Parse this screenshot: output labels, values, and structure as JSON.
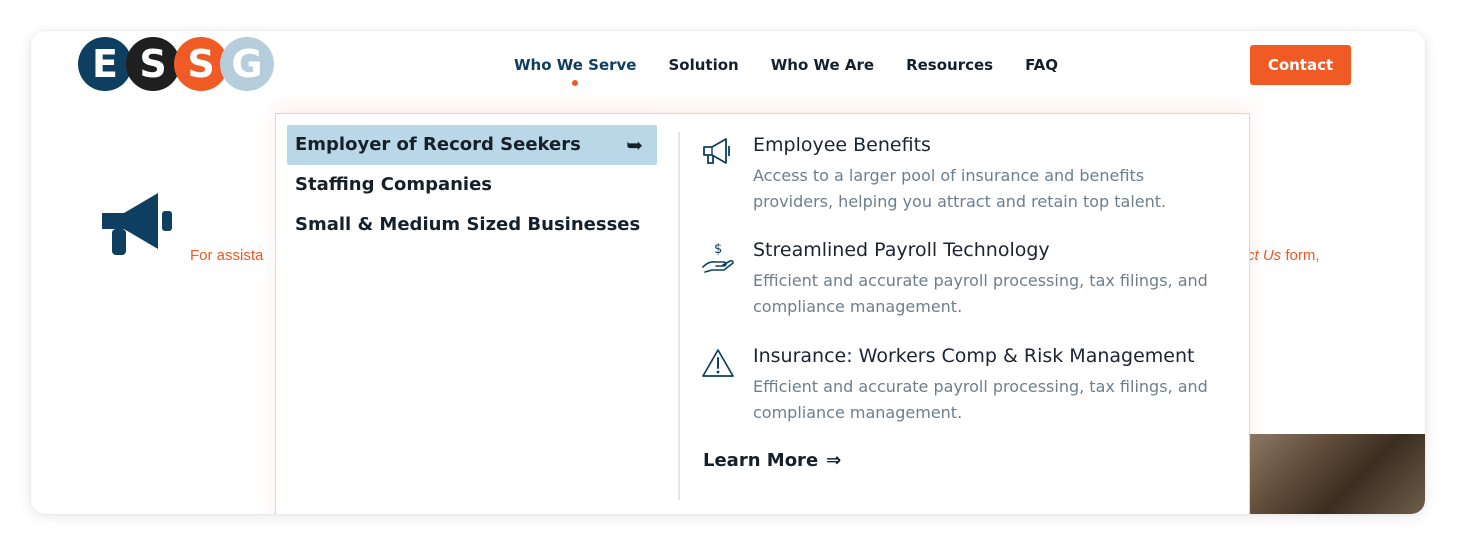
{
  "logo": {
    "letters": [
      "E",
      "S",
      "S",
      "G"
    ],
    "colors": [
      "#0e3f61",
      "#1f1f1f",
      "#f05a24",
      "#b6cedb"
    ]
  },
  "nav": {
    "items": [
      {
        "label": "Who We Serve",
        "active": true
      },
      {
        "label": "Solution"
      },
      {
        "label": "Who We Are"
      },
      {
        "label": "Resources"
      },
      {
        "label": "FAQ"
      }
    ],
    "contact_label": "Contact"
  },
  "background": {
    "megaphone_icon": "megaphone-icon",
    "assist_left": "For assista",
    "assist_right_italic": "ct Us",
    "assist_right_rest": " form,"
  },
  "dropdown": {
    "categories": [
      {
        "label": "Employer of Record Seekers",
        "selected": true,
        "arrow": "➥"
      },
      {
        "label": "Staffing Companies"
      },
      {
        "label": "Small & Medium Sized Businesses"
      }
    ],
    "features": [
      {
        "icon": "megaphone-icon",
        "title": "Employee Benefits",
        "description": "Access to a larger pool of insurance and benefits providers, helping you attract and retain top talent."
      },
      {
        "icon": "hand-dollar-icon",
        "title": "Streamlined Payroll Technology",
        "description": "Efficient and accurate payroll processing, tax filings, and compliance management."
      },
      {
        "icon": "warning-icon",
        "title": "Insurance: Workers Comp & Risk Management",
        "description": "Efficient and accurate payroll processing, tax filings, and compliance management."
      }
    ],
    "learn_more": "Learn More",
    "learn_more_arrow": "⇒"
  },
  "colors": {
    "accent": "#f05a24",
    "brand_navy": "#0e3f61",
    "selected_bg": "#b9d7e6"
  }
}
